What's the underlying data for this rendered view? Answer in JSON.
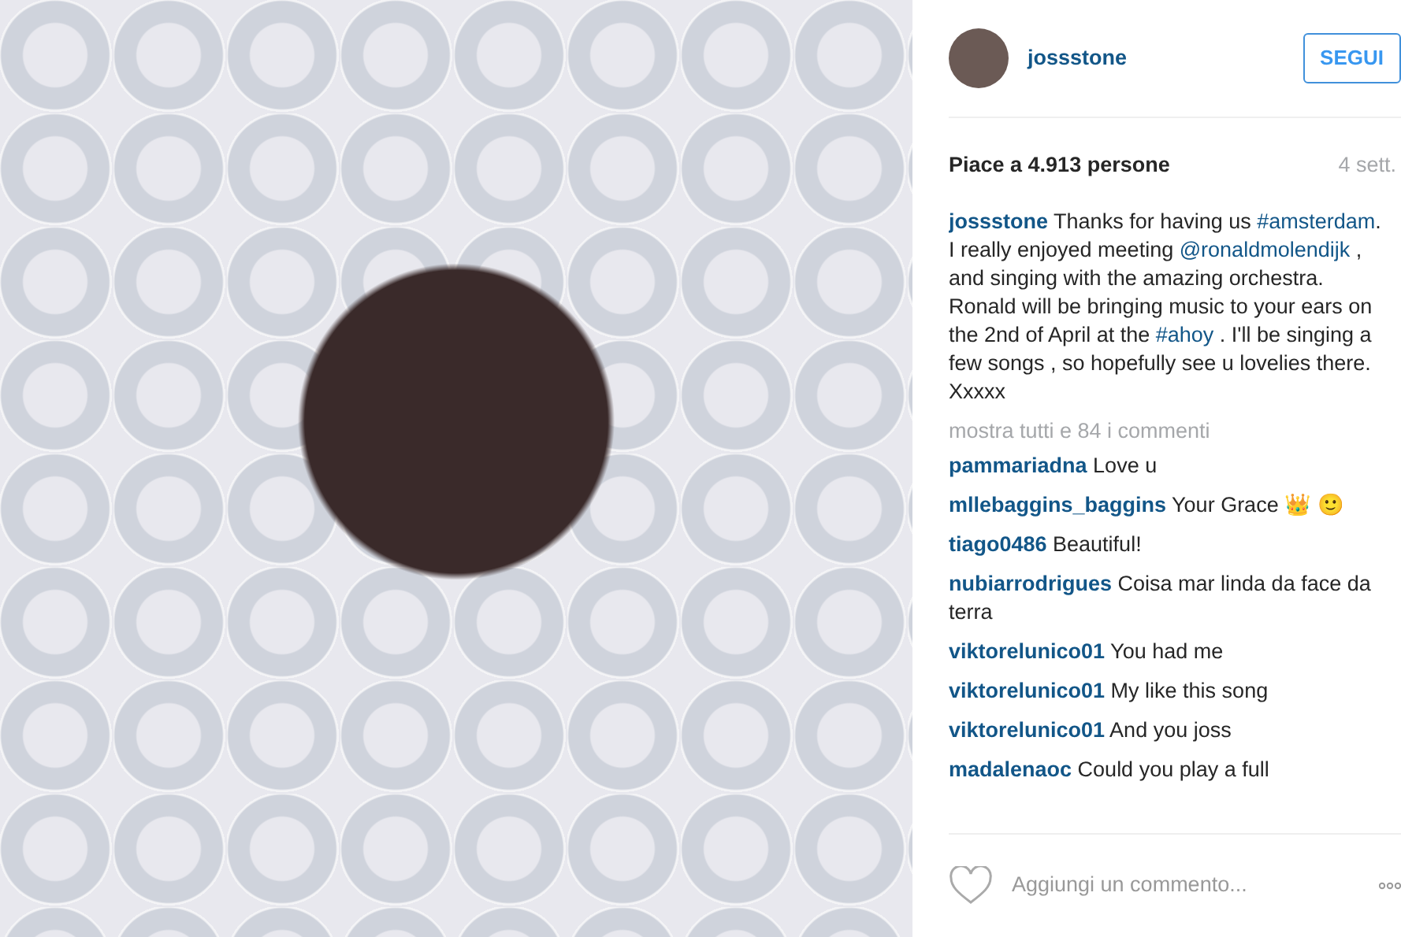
{
  "post": {
    "author": {
      "username": "jossstone"
    },
    "follow_button": "SEGUI",
    "likes": "Piace a 4.913 persone",
    "time": "4 sett.",
    "caption": {
      "username": "jossstone",
      "parts": [
        {
          "kind": "plain",
          "text": "Thanks for having us "
        },
        {
          "kind": "tag",
          "text": "#amsterdam"
        },
        {
          "kind": "plain",
          "text": ". I really enjoyed meeting "
        },
        {
          "kind": "tag",
          "text": "@ronaldmolendijk"
        },
        {
          "kind": "plain",
          "text": " , and singing with the amazing orchestra. Ronald will be bringing music to your ears on the 2nd of April at the "
        },
        {
          "kind": "tag",
          "text": "#ahoy"
        },
        {
          "kind": "plain",
          "text": " . I'll be singing a few songs , so hopefully see u lovelies there. Xxxxx"
        }
      ]
    },
    "show_all_comments": "mostra tutti e 84 i commenti",
    "comments": [
      {
        "username": "pammariadna",
        "text": "Love u"
      },
      {
        "username": "mllebaggins_baggins",
        "text": "Your Grace 👑 🙂"
      },
      {
        "username": "tiago0486",
        "text": "Beautiful!"
      },
      {
        "username": "nubiarrodrigues",
        "text": "Coisa mar linda da face da terra"
      },
      {
        "username": "viktorelunico01",
        "text": "You had me"
      },
      {
        "username": "viktorelunico01",
        "text": "My like this song"
      },
      {
        "username": "viktorelunico01",
        "text": "And you joss"
      },
      {
        "username": "madalenaoc",
        "text": "Could you play a full"
      }
    ],
    "comment_field": {
      "placeholder": "Aggiungi un commento..."
    }
  }
}
